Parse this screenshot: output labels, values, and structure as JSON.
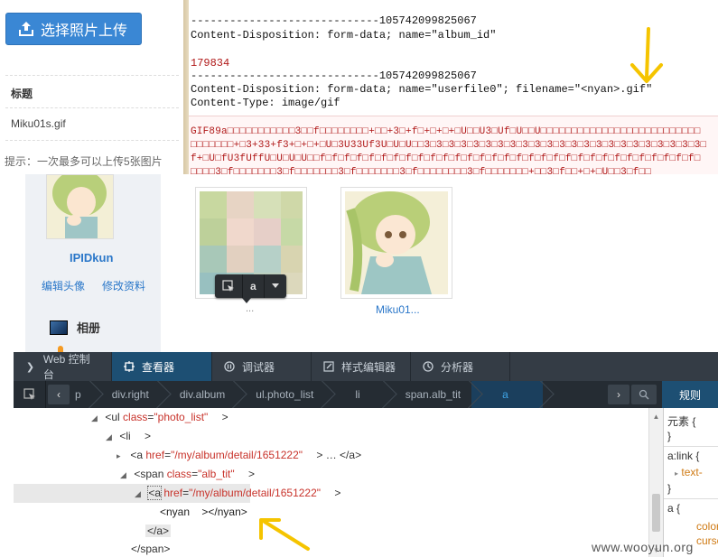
{
  "upload": {
    "button_label": "选择照片上传",
    "title_label": "标题",
    "filename": "Miku01s.gif",
    "hint": "提示：一次最多可以上传5张图片"
  },
  "request": {
    "lines": [
      "-----------------------------105742099825067",
      "Content-Disposition: form-data; name=\"album_id\"",
      "",
      "179834",
      "-----------------------------105742099825067",
      "Content-Disposition: form-data; name=\"userfile0\"; filename=\"<nyan>.gif\"",
      "Content-Type: image/gif"
    ],
    "gif_lines": [
      "GIF89a□□□□□□□□□□□3□□f□□□□□□□□+□□+3□+f□+□+□+□U□□U3□Uf□U□□U□□□□□□□□□□□□□□□□□□□□□□□□□□",
      "□□□□□□□+□3+33+f3+□+□+□U□3U33Uf3U□U□U□□3□3□3□3□3□3□3□3□3□3□3□3□3□3□3□3□3□3□3□3□3□3□3□",
      "f+□U□fU3fUffU□U□U□U□□f□f□f□f□f□f□f□f□f□f□f□f□f□f□f□f□f□f□f□f□f□f□f□f□f□f□f□f□f□f□f□",
      "□□□□3□f□□□□□□□3□f□□□□□□□3□f□□□□□□□3□f□□□□□□□□3□f□□□□□□□+□□3□f□□+□+□U□□3□f□□"
    ]
  },
  "profile": {
    "username": "IPIDkun",
    "edit_avatar": "编辑头像",
    "edit_profile": "修改资料",
    "album_nav": "相册"
  },
  "photos": {
    "card1_label": "...",
    "card2_label": "Miku01..."
  },
  "inspector_tooltip": {
    "tag": "a"
  },
  "devtools": {
    "tabs": [
      {
        "label": "Web 控制台",
        "icon": "console-icon",
        "active": false
      },
      {
        "label": "查看器",
        "icon": "inspector-icon",
        "active": true
      },
      {
        "label": "调试器",
        "icon": "debugger-icon",
        "active": false
      },
      {
        "label": "样式编辑器",
        "icon": "style-editor-icon",
        "active": false
      },
      {
        "label": "分析器",
        "icon": "profiler-icon",
        "active": false
      }
    ],
    "breadcrumbs": [
      "p",
      "div.right",
      "div.album",
      "ul.photo_list",
      "li",
      "span.alb_tit",
      "a"
    ],
    "rules_tab": "规则",
    "markup": {
      "ul_tag": "<ul",
      "ul_attr": "class",
      "ul_val": "\"photo_list\"",
      "ul_close": ">",
      "li_tag": "<li",
      "li_close": ">",
      "a1_tag": "<a",
      "a1_attr": "href",
      "a1_val": "\"/my/album/detail/1651222\"",
      "a1_close": "> … </a>",
      "span_tag": "<span",
      "span_attr": "class",
      "span_val": "\"alb_tit\"",
      "span_close": ">",
      "a2_tag": "<a",
      "a2_attr": "href",
      "a2_val": "\"/my/album/detail/1651222\"",
      "a2_close": ">",
      "nyan_text": "<nyan    ></nyan>",
      "a_end": "</a>",
      "span_end": "</span>"
    },
    "rules": {
      "element_head": "元素 {",
      "element_close": "}",
      "alink_head": "a:link {",
      "alink_prop": "text-",
      "alink_close": "}",
      "a_head": "a {",
      "a_prop1": "color",
      "a_prop2": "curso"
    }
  },
  "watermark": "www.wooyun.org",
  "colors": {
    "upload_button": "#3a87d4",
    "devtools_bg": "#343c45",
    "active_tab": "#1d4f73",
    "arrow": "#f5c400",
    "link": "#2a77c9"
  }
}
